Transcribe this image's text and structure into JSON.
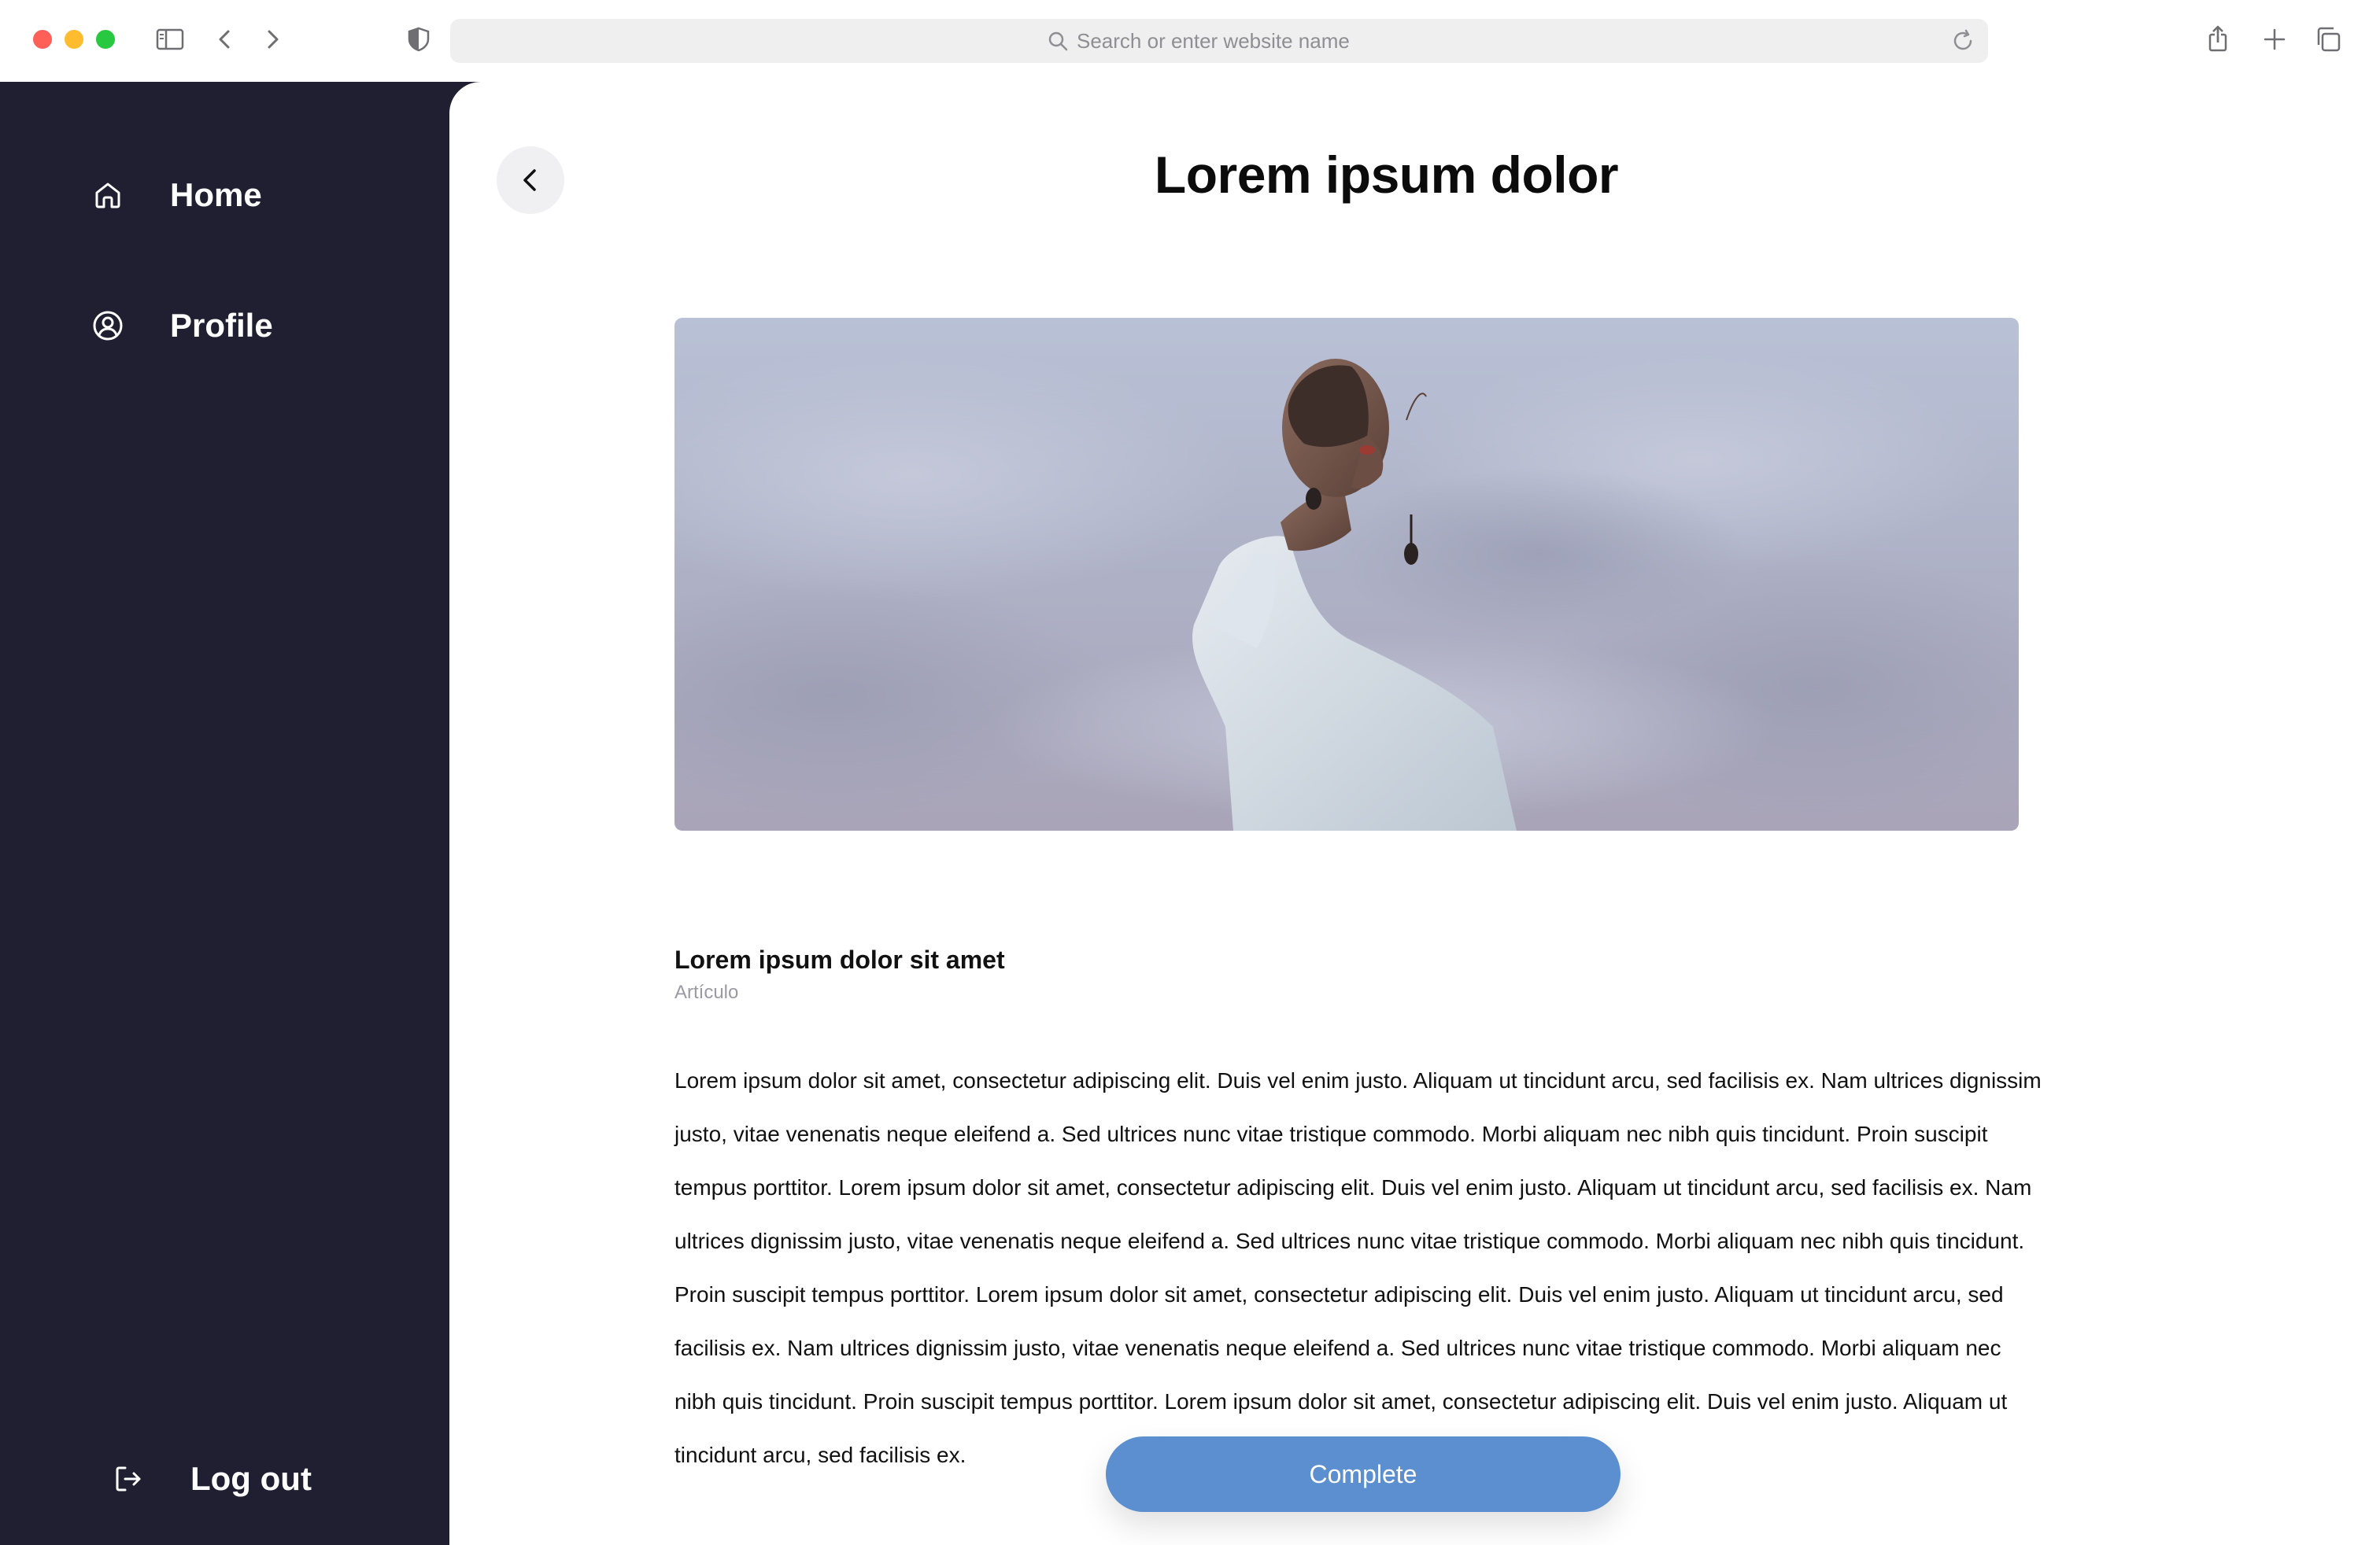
{
  "browser": {
    "url_placeholder": "Search or enter website name"
  },
  "sidebar": {
    "items": [
      {
        "label": "Home",
        "icon": "home-icon"
      },
      {
        "label": "Profile",
        "icon": "user-circle-icon"
      }
    ],
    "logout_label": "Log out"
  },
  "main": {
    "title": "Lorem ipsum dolor",
    "article": {
      "title": "Lorem ipsum dolor sit amet",
      "type": "Artículo",
      "body": "Lorem ipsum dolor sit amet, consectetur adipiscing elit. Duis vel enim justo. Aliquam ut tincidunt arcu, sed facilisis ex. Nam ultrices dignissim justo, vitae venenatis neque eleifend a. Sed ultrices nunc vitae tristique commodo. Morbi aliquam nec nibh quis tincidunt. Proin suscipit tempus porttitor. Lorem ipsum dolor sit amet, consectetur adipiscing elit. Duis vel enim justo. Aliquam ut tincidunt arcu, sed facilisis ex. Nam ultrices dignissim justo, vitae venenatis neque eleifend a. Sed ultrices nunc vitae tristique commodo. Morbi aliquam nec nibh quis tincidunt. Proin suscipit tempus porttitor. Lorem ipsum dolor sit amet, consectetur adipiscing elit. Duis vel enim justo. Aliquam ut tincidunt arcu, sed facilisis ex. Nam ultrices dignissim justo, vitae venenatis neque eleifend a. Sed ultrices nunc vitae tristique commodo. Morbi aliquam nec nibh quis tincidunt. Proin suscipit tempus porttitor. Lorem ipsum dolor sit amet, consectetur adipiscing elit. Duis vel enim justo. Aliquam ut tincidunt arcu, sed facilisis ex."
    },
    "complete_label": "Complete"
  },
  "colors": {
    "sidebar_bg": "#201f31",
    "accent": "#5b8fcf"
  }
}
